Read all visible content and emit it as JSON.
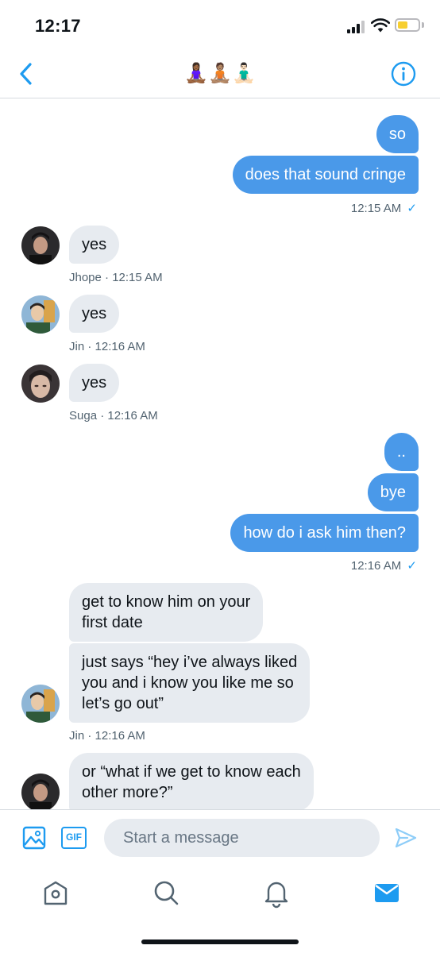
{
  "status_bar": {
    "time": "12:17",
    "battery_color": "#f7cf31"
  },
  "header": {
    "title": "🧘🏾‍♀️🧘🏽🧘🏻‍♂️"
  },
  "colors": {
    "accent": "#1d9bf0",
    "sent_bubble": "#4a99e9",
    "received_bubble": "#e7ebf0"
  },
  "messages": [
    {
      "dir": "sent",
      "text": "so"
    },
    {
      "dir": "sent",
      "text": "does that sound cringe"
    },
    {
      "dir": "meta_sent",
      "text": "12:15 AM"
    },
    {
      "dir": "received",
      "text": "yes"
    },
    {
      "dir": "meta_received",
      "text": "Jhope · 12:15 AM"
    },
    {
      "dir": "received",
      "text": "yes"
    },
    {
      "dir": "meta_received",
      "text": "Jin · 12:16 AM"
    },
    {
      "dir": "received",
      "text": "yes"
    },
    {
      "dir": "meta_received",
      "text": "Suga · 12:16 AM"
    },
    {
      "dir": "sent",
      "text": ".."
    },
    {
      "dir": "sent",
      "text": "bye"
    },
    {
      "dir": "sent",
      "text": "how do i ask him then?"
    },
    {
      "dir": "meta_sent",
      "text": "12:16 AM"
    },
    {
      "dir": "received",
      "text": "get to know him on your\nfirst date"
    },
    {
      "dir": "received",
      "text": "just says “hey i’ve always liked\nyou and i know you like me so\nlet’s go out”"
    },
    {
      "dir": "meta_received",
      "text": "Jin · 12:16 AM"
    },
    {
      "dir": "received",
      "text": "or “what if we get to know each\nother more?”"
    }
  ],
  "read_check": "✓",
  "composer": {
    "placeholder": "Start a message",
    "image_icon": "image-icon",
    "gif_label": "GIF",
    "send_icon": "send-icon"
  },
  "tabs": [
    {
      "name": "home",
      "icon": "home-icon"
    },
    {
      "name": "search",
      "icon": "search-icon"
    },
    {
      "name": "notifications",
      "icon": "bell-icon"
    },
    {
      "name": "messages",
      "icon": "mail-icon",
      "active": true
    }
  ]
}
